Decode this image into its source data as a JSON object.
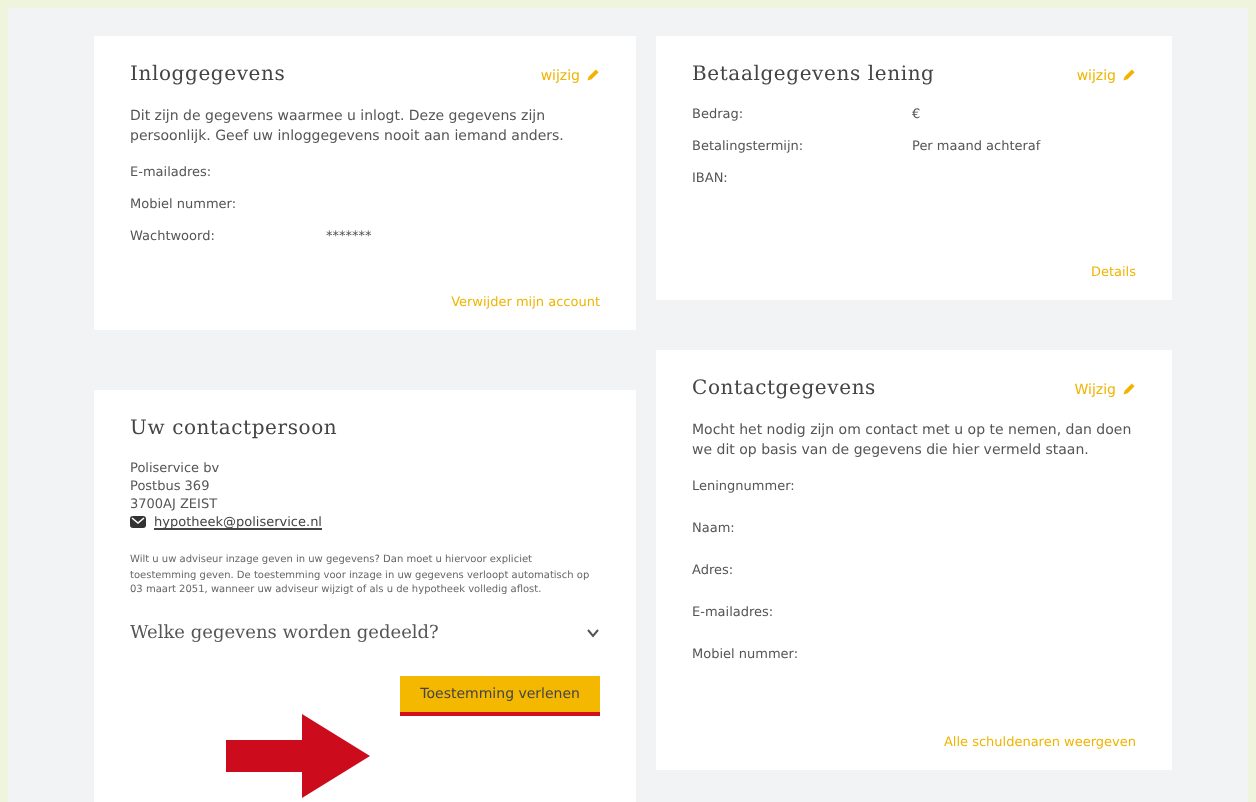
{
  "login": {
    "title": "Inloggegevens",
    "edit": "wijzig",
    "intro": "Dit zijn de gegevens waarmee u inlogt. Deze gegevens zijn persoonlijk. Geef uw inloggegevens nooit aan iemand anders.",
    "fields": [
      {
        "label": "E-mailadres:"
      },
      {
        "label": "Mobiel nummer:"
      },
      {
        "label": "Wachtwoord:",
        "value": "*******"
      }
    ],
    "link": "Verwijder mijn account"
  },
  "payment": {
    "title": "Betaalgegevens lening",
    "edit": "wijzig",
    "fields": [
      {
        "label": "Bedrag:",
        "value": "€"
      },
      {
        "label": "Betalingstermijn:",
        "value": "Per maand achteraf"
      },
      {
        "label": "IBAN:"
      }
    ],
    "link": "Details"
  },
  "contact_person": {
    "title": "Uw contactpersoon",
    "address": [
      "Poliservice bv",
      "Postbus 369",
      "3700AJ ZEIST"
    ],
    "email": "hypotheek@poliservice.nl",
    "text": "Wilt u uw adviseur inzage geven in uw gegevens? Dan moet u hiervoor expliciet toestemming geven. De toestemming voor inzage in uw gegevens verloopt automatisch op 03 maart 2051, wanneer uw adviseur wijzigt of als u de hypotheek volledig aflost.",
    "accordion": {
      "title": "Welke gegevens worden gedeeld?",
      "expanded": false
    },
    "button": "Toestemming verlenen"
  },
  "contact": {
    "title": "Contactgegevens",
    "edit": "Wijzig",
    "intro": "Mocht het nodig zijn om contact met u op te nemen, dan doen we dit op basis van de gegevens die hier vermeld staan.",
    "fields": [
      {
        "label": "Leningnummer:"
      },
      {
        "label": "Naam:"
      },
      {
        "label": "Adres:"
      },
      {
        "label": "E-mailadres:"
      },
      {
        "label": "Mobiel nummer:"
      }
    ],
    "link": "Alle schuldenaren weergeven"
  }
}
